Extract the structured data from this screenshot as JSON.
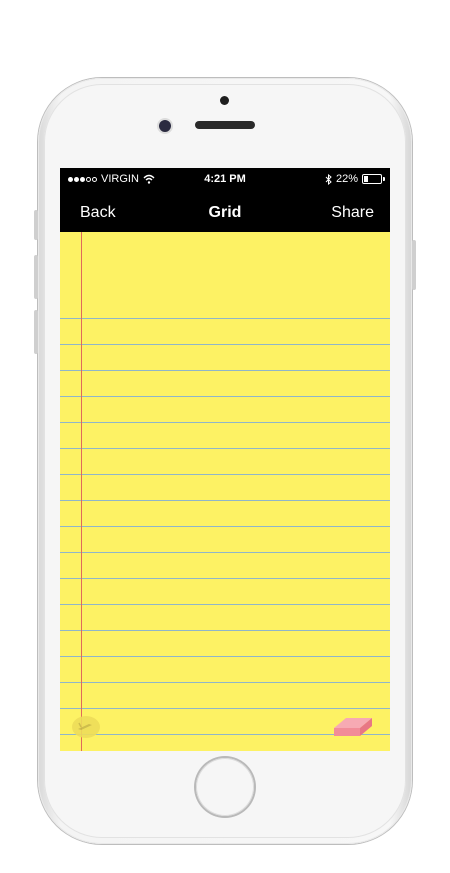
{
  "status_bar": {
    "carrier": "VIRGIN",
    "time": "4:21 PM",
    "battery": "22%",
    "signal_bars": 3,
    "signal_total": 5,
    "battery_level": 0.22
  },
  "nav": {
    "back": "Back",
    "title": "Grid",
    "share": "Share"
  },
  "notepad": {
    "paper_color": "#fdf264",
    "rule_color": "#8fb6c9",
    "margin_color": "#e06a5a"
  },
  "icons": {
    "pen": "pen-icon",
    "eraser": "eraser-icon",
    "wifi": "wifi-icon",
    "bluetooth": "bluetooth-icon",
    "battery": "battery-icon"
  }
}
